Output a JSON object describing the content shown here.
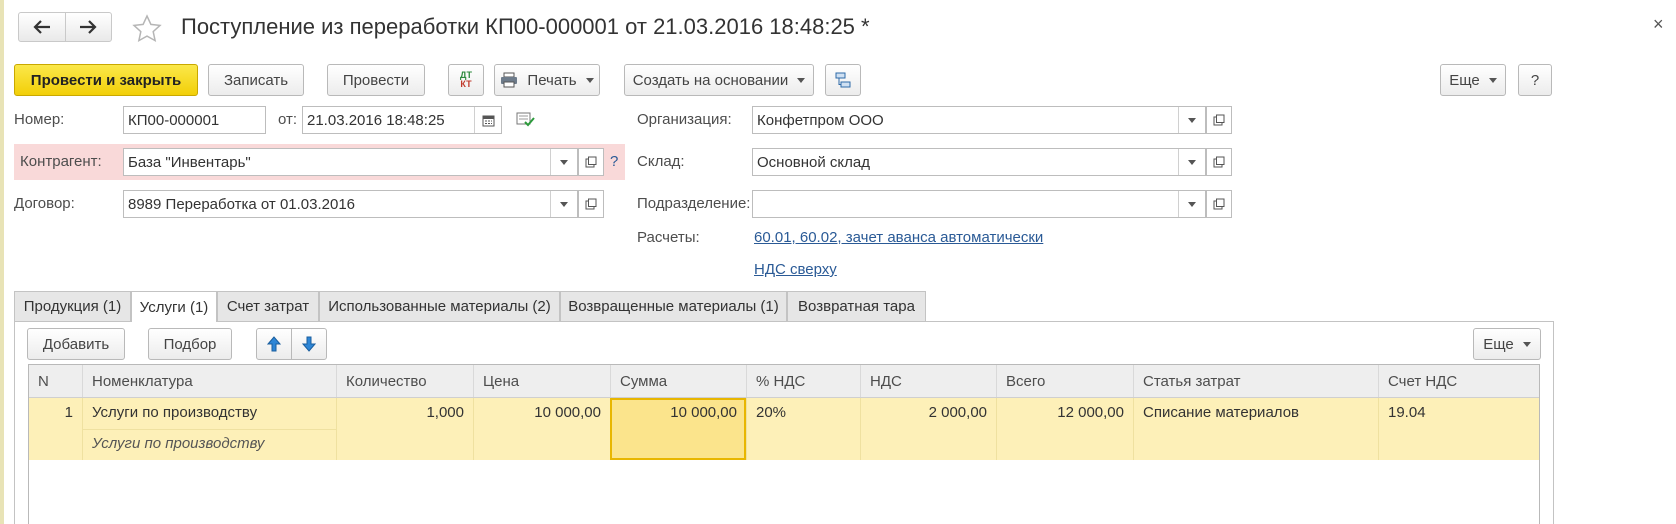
{
  "window": {
    "title": "Поступление из переработки КП00-000001 от 21.03.2016 18:48:25 *",
    "close_glyph": "×"
  },
  "toolbar": {
    "post_and_close": "Провести и закрыть",
    "save": "Записать",
    "post": "Провести",
    "dt_kt_top": "ДТ",
    "dt_kt_bottom": "КТ",
    "print": "Печать",
    "create_based_on": "Создать на основании",
    "more": "Еще",
    "help": "?"
  },
  "form": {
    "number_label": "Номер:",
    "number_value": "КП00-000001",
    "date_label": "от:",
    "date_value": "21.03.2016 18:48:25",
    "counterparty_label": "Контрагент:",
    "counterparty_value": "База \"Инвентарь\"",
    "counterparty_hint": "?",
    "contract_label": "Договор:",
    "contract_value": "8989 Переработка от 01.03.2016",
    "organization_label": "Организация:",
    "organization_value": "Конфетпром ООО",
    "warehouse_label": "Склад:",
    "warehouse_value": "Основной склад",
    "department_label": "Подразделение:",
    "department_value": "",
    "settlements_label": "Расчеты:",
    "settlements_link": "60.01, 60.02, зачет аванса автоматически",
    "vat_link": "НДС сверху"
  },
  "tabs": [
    {
      "label": "Продукция (1)"
    },
    {
      "label": "Услуги (1)"
    },
    {
      "label": "Счет затрат"
    },
    {
      "label": "Использованные материалы (2)"
    },
    {
      "label": "Возвращенные материалы (1)"
    },
    {
      "label": "Возвратная тара"
    }
  ],
  "table_toolbar": {
    "add": "Добавить",
    "pick": "Подбор",
    "more": "Еще"
  },
  "table": {
    "columns": [
      "N",
      "Номенклатура",
      "Количество",
      "Цена",
      "Сумма",
      "% НДС",
      "НДС",
      "Всего",
      "Статья затрат",
      "Счет НДС"
    ],
    "rows": [
      {
        "n": "1",
        "item": "Услуги по производству",
        "item_sub": "Услуги по производству",
        "qty": "1,000",
        "price": "10 000,00",
        "sum": "10 000,00",
        "vat_rate": "20%",
        "vat": "2 000,00",
        "total": "12 000,00",
        "cost_item": "Списание материалов",
        "vat_account": "19.04"
      }
    ]
  },
  "colors": {
    "primary_button": "#f5d615",
    "selected_row": "#fdf0b8",
    "selected_cell": "#fbe48c",
    "error_highlight": "#f9d9d9",
    "link": "#2a5a96"
  }
}
